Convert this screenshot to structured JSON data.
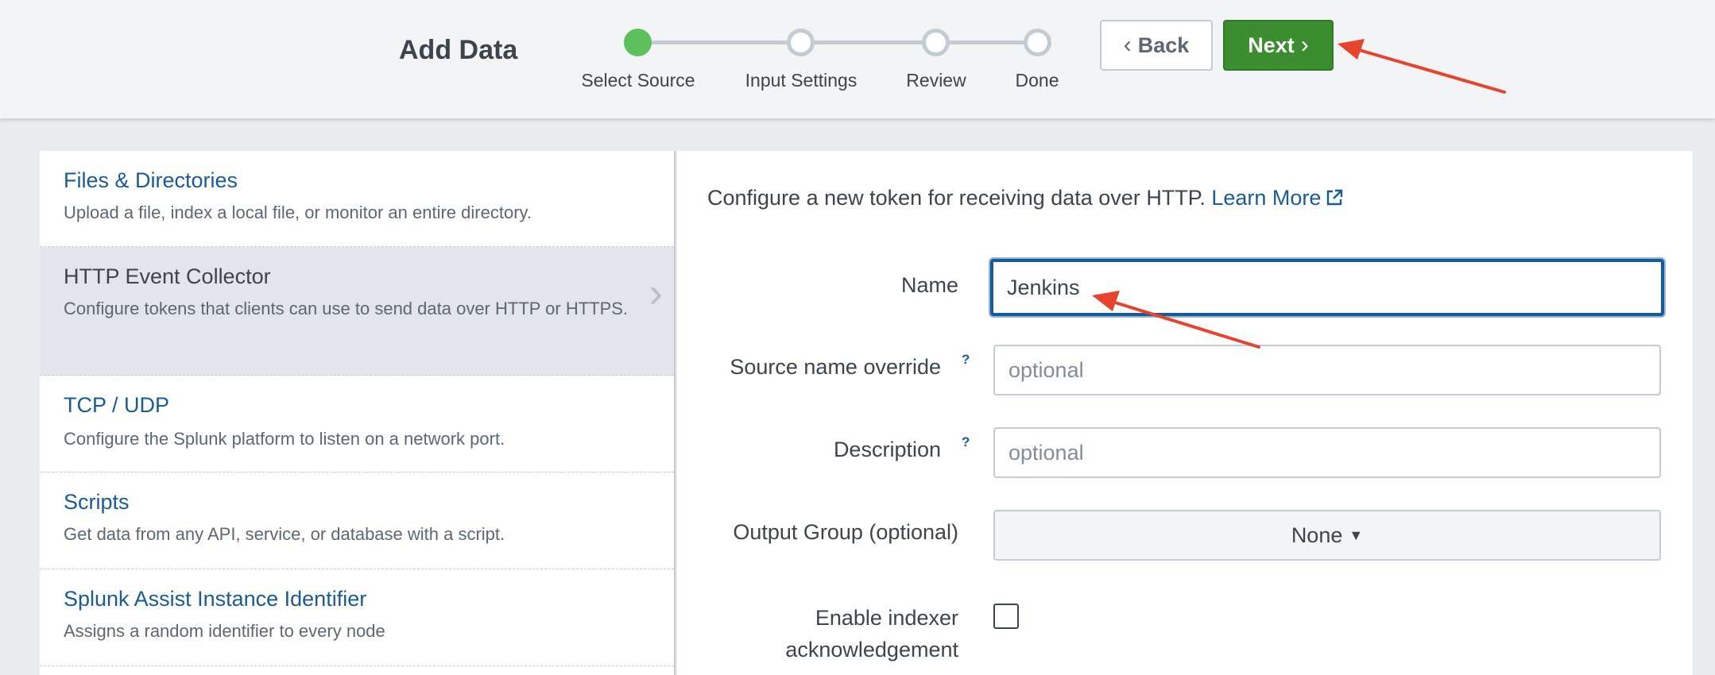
{
  "header": {
    "title": "Add Data",
    "steps": [
      {
        "label": "Select Source",
        "active": true
      },
      {
        "label": "Input Settings",
        "active": false
      },
      {
        "label": "Review",
        "active": false
      },
      {
        "label": "Done",
        "active": false
      }
    ],
    "back_label": "Back",
    "next_label": "Next"
  },
  "sources": [
    {
      "title": "Files & Directories",
      "description": "Upload a file, index a local file, or monitor an entire directory."
    },
    {
      "title": "HTTP Event Collector",
      "description": "Configure tokens that clients can use to send data over HTTP or HTTPS."
    },
    {
      "title": "TCP / UDP",
      "description": "Configure the Splunk platform to listen on a network port."
    },
    {
      "title": "Scripts",
      "description": "Get data from any API, service, or database with a script."
    },
    {
      "title": "Splunk Assist Instance Identifier",
      "description": "Assigns a random identifier to every node"
    }
  ],
  "selected_source_index": 1,
  "form": {
    "intro": "Configure a new token for receiving data over HTTP.",
    "learn_more": "Learn More",
    "name_label": "Name",
    "name_value": "Jenkins",
    "source_override_label": "Source name override",
    "source_override_placeholder": "optional",
    "description_label": "Description",
    "description_placeholder": "optional",
    "help_mark": "?",
    "output_group_label": "Output Group (optional)",
    "output_group_value": "None",
    "indexer_ack_label_line1": "Enable indexer",
    "indexer_ack_label_line2": "acknowledgement",
    "indexer_ack_checked": false
  },
  "colors": {
    "accent_green": "#3c8d2f",
    "step_active": "#5cc05c",
    "link_blue": "#1a5b94",
    "annotation_red": "#e8432e"
  },
  "icons": [
    "chevron-left-icon",
    "chevron-right-icon",
    "external-link-icon",
    "caret-down-icon"
  ]
}
